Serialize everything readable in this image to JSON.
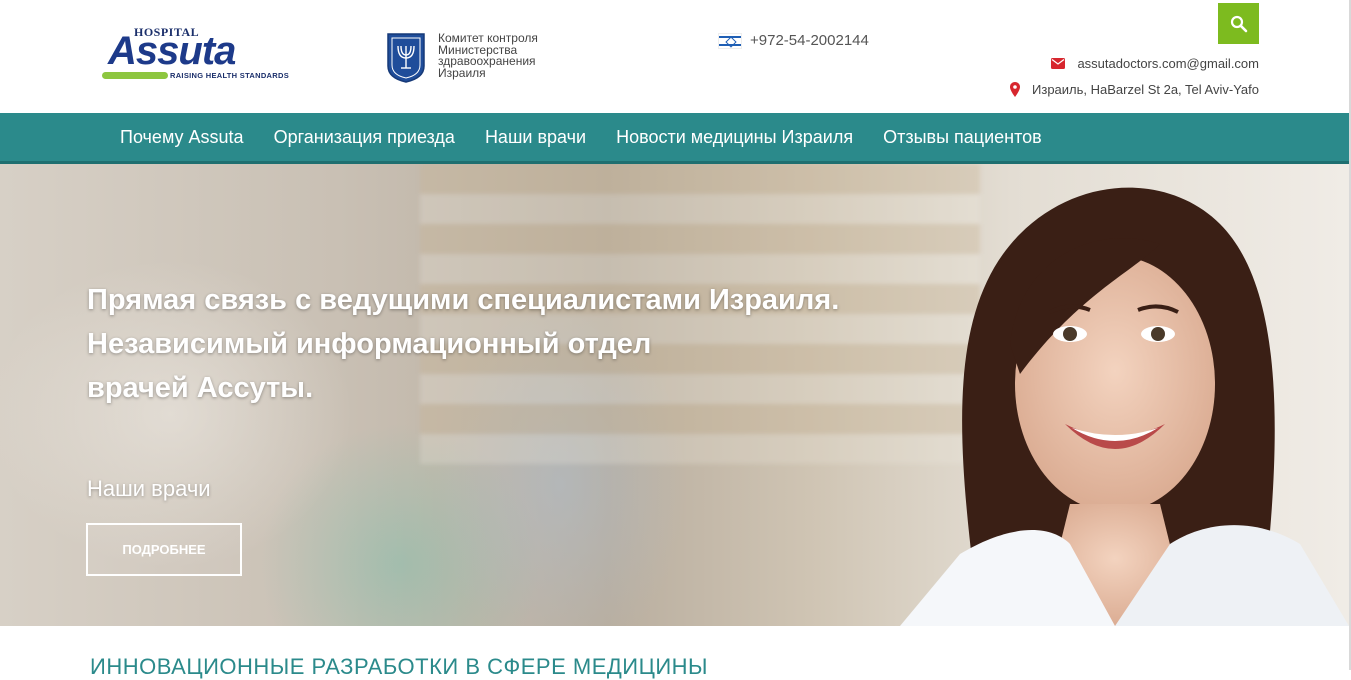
{
  "header": {
    "logo": {
      "top": "HOSPITAL",
      "brand": "Assuta",
      "tagline": "RAISING HEALTH STANDARDS"
    },
    "committee": {
      "lines": [
        "Комитет контроля",
        "Министерства",
        "здравоохранения",
        "Израиля"
      ]
    },
    "phone": "+972-54-2002144",
    "email": "assutadoctors.com@gmail.com",
    "address": "Израиль, HaBarzel St 2a, Tel Aviv-Yafo"
  },
  "nav": {
    "items": [
      {
        "label": "Почему Assuta"
      },
      {
        "label": "Организация приезда"
      },
      {
        "label": "Наши врачи"
      },
      {
        "label": "Новости медицины Израиля"
      },
      {
        "label": "Отзывы пациентов"
      }
    ]
  },
  "hero": {
    "title_lines": [
      "Прямая связь с ведущими специалистами Израиля.",
      "Независимый информационный отдел",
      "врачей Ассуты."
    ],
    "subtitle": "Наши врачи",
    "button": "ПОДРОБНЕЕ"
  },
  "section": {
    "title": "ИННОВАЦИОННЫЕ РАЗРАБОТКИ В СФЕРЕ МЕДИЦИНЫ"
  },
  "colors": {
    "nav": "#2b8a8b",
    "search": "#7dbb1f",
    "brand": "#1d3a8a",
    "accent_green": "#8dc63f"
  },
  "icons": [
    "search-icon",
    "mail-icon",
    "map-pin-icon",
    "israel-flag-icon",
    "state-emblem-icon"
  ]
}
